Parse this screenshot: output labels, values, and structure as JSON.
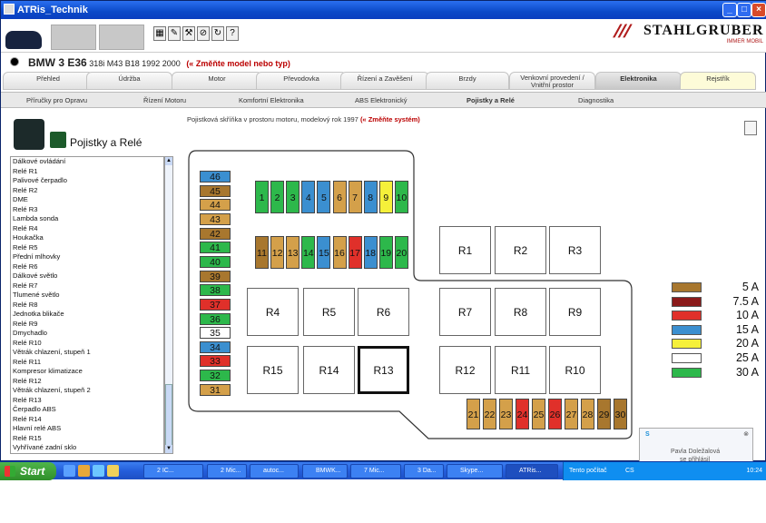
{
  "window": {
    "title": "ATRis_Technik"
  },
  "toolbar": {
    "icon_names": [
      "table-icon",
      "edit-icon",
      "tools-icon",
      "stop-icon",
      "refresh-icon",
      "help-icon"
    ]
  },
  "logo": {
    "brand": "STAHLGRUBER",
    "sub": "IMMER MOBIL"
  },
  "model": {
    "make_model": "BMW 3 E36",
    "details": "318i M43 B18 1992 2000",
    "change_link": "(« Změňte model nebo typ)"
  },
  "main_tabs": [
    "Přehled",
    "Údržba",
    "Motor",
    "Převodovka",
    "Řízení a Zavěšení",
    "Brzdy",
    "Venkovní provedení / Vnitřní prostor",
    "Elektronika",
    "Rejstřík"
  ],
  "main_tabs_selected": "Elektronika",
  "sub_tabs": [
    "Příručky pro Opravu",
    "Řízení Motoru",
    "Komfortní Elektronika",
    "ABS Elektronický",
    "Pojistky a Relé",
    "Diagnostika"
  ],
  "sub_tabs_selected": "Pojistky a Relé",
  "left": {
    "title": "Pojistky a Relé",
    "list": [
      "Dálkové ovládání",
      "Relé R1",
      "Palivové čerpadlo",
      "Relé R2",
      "DME",
      "Relé R3",
      "Lambda sonda",
      "Relé R4",
      "Houkačka",
      "Relé R5",
      "Přední mlhovky",
      "Relé R6",
      "Dálkové světlo",
      "Relé R7",
      "Tlumené světlo",
      "Relé R8",
      "Jednotka blikače",
      "Relé R9",
      "Dmychadlo",
      "Relé R10",
      "Větrák chlazení, stupeň 1",
      "Relé R11",
      "Kompresor klimatizace",
      "Relé R12",
      "Větrák chlazení, stupeň 2",
      "Relé R13",
      "Čerpadlo ABS",
      "Relé R14",
      "Hlavní relé ABS",
      "Relé R15",
      "Vyhřívané zadní sklo"
    ]
  },
  "content": {
    "breadcrumb": "Pojistková skříňka v prostoru motoru, modelový rok 1997",
    "change_system": "(« Změňte systém)"
  },
  "fuses_left_column": [
    {
      "n": "46",
      "color": "#3b8fd0"
    },
    {
      "n": "45",
      "color": "#a8772e"
    },
    {
      "n": "44",
      "color": "#d4a04a"
    },
    {
      "n": "43",
      "color": "#d4a04a"
    },
    {
      "n": "42",
      "color": "#a8772e"
    },
    {
      "n": "41",
      "color": "#2db84b"
    },
    {
      "n": "40",
      "color": "#2db84b"
    },
    {
      "n": "39",
      "color": "#a8772e"
    },
    {
      "n": "38",
      "color": "#2db84b"
    },
    {
      "n": "37",
      "color": "#e0302a"
    },
    {
      "n": "36",
      "color": "#2db84b"
    },
    {
      "n": "35",
      "color": "#ffffff"
    },
    {
      "n": "34",
      "color": "#3b8fd0"
    },
    {
      "n": "33",
      "color": "#e0302a"
    },
    {
      "n": "32",
      "color": "#2db84b"
    },
    {
      "n": "31",
      "color": "#d4a04a"
    }
  ],
  "fuses_top_row": [
    {
      "n": "1",
      "color": "#2db84b"
    },
    {
      "n": "2",
      "color": "#2db84b"
    },
    {
      "n": "3",
      "color": "#2db84b"
    },
    {
      "n": "4",
      "color": "#3b8fd0"
    },
    {
      "n": "5",
      "color": "#3b8fd0"
    },
    {
      "n": "6",
      "color": "#d4a04a"
    },
    {
      "n": "7",
      "color": "#d4a04a"
    },
    {
      "n": "8",
      "color": "#3b8fd0"
    },
    {
      "n": "9",
      "color": "#f5f03a"
    },
    {
      "n": "10",
      "color": "#2db84b"
    }
  ],
  "fuses_second_row": [
    {
      "n": "11",
      "color": "#a8772e"
    },
    {
      "n": "12",
      "color": "#d4a04a"
    },
    {
      "n": "13",
      "color": "#d4a04a"
    },
    {
      "n": "14",
      "color": "#2db84b"
    },
    {
      "n": "15",
      "color": "#3b8fd0"
    },
    {
      "n": "16",
      "color": "#d4a04a"
    },
    {
      "n": "17",
      "color": "#e0302a"
    },
    {
      "n": "18",
      "color": "#3b8fd0"
    },
    {
      "n": "19",
      "color": "#2db84b"
    },
    {
      "n": "20",
      "color": "#2db84b"
    }
  ],
  "fuses_bottom_row": [
    {
      "n": "21",
      "color": "#d4a04a"
    },
    {
      "n": "22",
      "color": "#d4a04a"
    },
    {
      "n": "23",
      "color": "#d4a04a"
    },
    {
      "n": "24",
      "color": "#e0302a"
    },
    {
      "n": "25",
      "color": "#d4a04a"
    },
    {
      "n": "26",
      "color": "#e0302a"
    },
    {
      "n": "27",
      "color": "#d4a04a"
    },
    {
      "n": "28",
      "color": "#d4a04a"
    },
    {
      "n": "29",
      "color": "#a8772e"
    },
    {
      "n": "30",
      "color": "#a8772e"
    }
  ],
  "relays": [
    "R1",
    "R2",
    "R3",
    "R4",
    "R5",
    "R6",
    "R7",
    "R8",
    "R9",
    "R15",
    "R14",
    "R13",
    "R12",
    "R11",
    "R10"
  ],
  "legend": [
    {
      "label": "5 A",
      "color": "#a8772e"
    },
    {
      "label": "7.5 A",
      "color": "#8b1a1a"
    },
    {
      "label": "10 A",
      "color": "#e0302a"
    },
    {
      "label": "15 A",
      "color": "#3b8fd0"
    },
    {
      "label": "20 A",
      "color": "#f5f03a"
    },
    {
      "label": "25 A",
      "color": "#ffffff"
    },
    {
      "label": "30 A",
      "color": "#2db84b"
    }
  ],
  "skype_popup": {
    "name": "Pavla Doležalová",
    "status": "se přihlásil"
  },
  "taskbar": {
    "start": "Start",
    "buttons": [
      "2 IC...",
      "2 Mic...",
      "autoc...",
      "BMWK...",
      "7 Mic...",
      "3 Da...",
      "Skype...",
      "ATRis..."
    ],
    "active": "ATRis...",
    "tray_text": "Tento počítač",
    "lang": "CS",
    "clock": "10:24"
  }
}
